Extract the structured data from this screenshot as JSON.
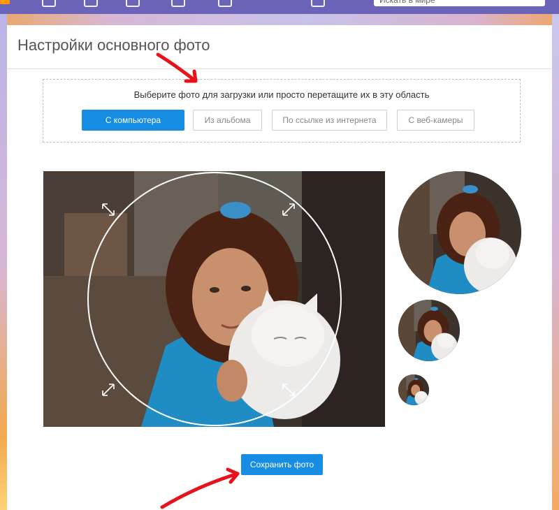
{
  "topbar": {
    "search_placeholder": "Искать в мире"
  },
  "page": {
    "title": "Настройки основного фото",
    "upload": {
      "instruction": "Выберите фото для загрузки или просто перетащите их в эту область",
      "buttons": {
        "computer": "С компьютера",
        "album": "Из альбома",
        "url": "По ссылке из интернета",
        "webcam": "С веб-камеры"
      }
    },
    "save_label": "Сохранить фото"
  },
  "colors": {
    "accent": "#168de2",
    "topbar": "#6b63b8",
    "annotation_arrow": "#e8121b"
  },
  "icons": [
    "resize-arrow-icon",
    "resize-arrow-icon",
    "resize-arrow-icon",
    "resize-arrow-icon"
  ]
}
